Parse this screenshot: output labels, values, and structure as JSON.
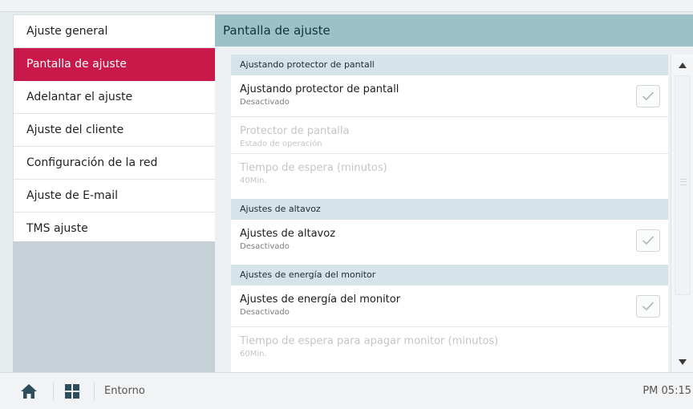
{
  "sidebar": {
    "items": [
      {
        "label": "Ajuste general"
      },
      {
        "label": "Pantalla de ajuste"
      },
      {
        "label": "Adelantar el ajuste"
      },
      {
        "label": "Ajuste del cliente"
      },
      {
        "label": "Configuración de la red"
      },
      {
        "label": "Ajuste de E-mail"
      },
      {
        "label": "TMS ajuste"
      }
    ],
    "active_index": 1
  },
  "main": {
    "title": "Pantalla de ajuste",
    "sections": [
      {
        "header": "Ajustando protector de pantall",
        "rows": [
          {
            "title": "Ajustando protector de pantall",
            "sub": "Desactivado",
            "checkbox": true,
            "enabled": true
          },
          {
            "title": "Protector de pantalla",
            "sub": "Estado de operación",
            "checkbox": false,
            "enabled": false
          },
          {
            "title": "Tiempo de espera (minutos)",
            "sub": "40Min.",
            "checkbox": false,
            "enabled": false
          }
        ]
      },
      {
        "header": "Ajustes de altavoz",
        "rows": [
          {
            "title": "Ajustes de altavoz",
            "sub": "Desactivado",
            "checkbox": true,
            "enabled": true
          }
        ]
      },
      {
        "header": "Ajustes de energía del monitor",
        "rows": [
          {
            "title": "Ajustes de energía del monitor",
            "sub": "Desactivado",
            "checkbox": true,
            "enabled": true
          },
          {
            "title": "Tiempo de espera para apagar monitor (minutos)",
            "sub": "60Min.",
            "checkbox": false,
            "enabled": false
          }
        ]
      }
    ]
  },
  "bottombar": {
    "home_icon": "home-icon",
    "grid_icon": "grid-icon",
    "label": "Entorno",
    "time": "PM 05:15"
  },
  "colors": {
    "accent": "#c8194a",
    "header": "#9cc2c8",
    "section": "#d5e4e8",
    "icon": "#2e4d5a"
  }
}
